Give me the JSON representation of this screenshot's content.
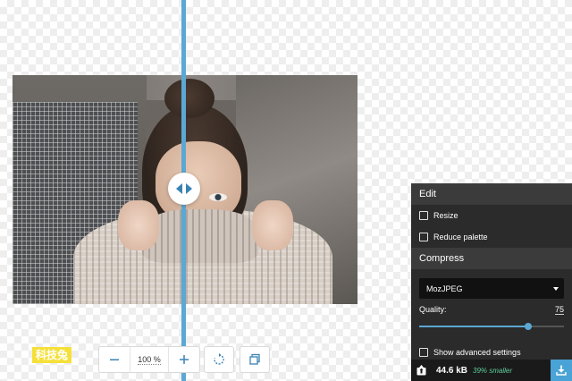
{
  "zoom": {
    "minus_icon": "minus-icon",
    "value": "100 %",
    "plus_icon": "plus-icon"
  },
  "watermark": {
    "text": "科技兔"
  },
  "edit": {
    "header": "Edit",
    "resize_label": "Resize",
    "resize_checked": false,
    "reduce_palette_label": "Reduce palette",
    "reduce_palette_checked": false
  },
  "compress": {
    "header": "Compress",
    "method": "MozJPEG",
    "quality_label": "Quality:",
    "quality_value": "75",
    "quality_fraction": 0.75,
    "advanced_label": "Show advanced settings",
    "advanced_checked": false
  },
  "footer": {
    "file_size": "44.6 kB",
    "savings": "39% smaller"
  },
  "colors": {
    "accent": "#5ba8d4",
    "panel_bg": "#222222",
    "savings": "#5fcf9c"
  }
}
